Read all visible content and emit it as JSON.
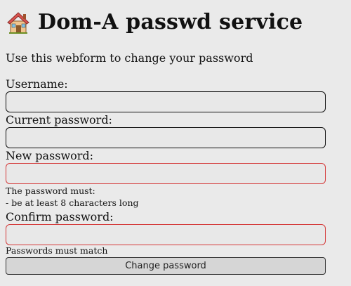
{
  "header": {
    "title": "Dom-A passwd service",
    "icon": "house-icon"
  },
  "intro": "Use this webform to change your password",
  "form": {
    "username": {
      "label": "Username:",
      "value": ""
    },
    "current_password": {
      "label": "Current password:",
      "value": ""
    },
    "new_password": {
      "label": "New password:",
      "value": "",
      "hint_lines": [
        "The password must:",
        "- be at least 8 characters long"
      ]
    },
    "confirm_password": {
      "label": "Confirm password:",
      "value": "",
      "hint": "Passwords must match"
    },
    "submit_label": "Change password"
  },
  "colors": {
    "background": "#eaeaea",
    "invalid_border": "#d53b3b",
    "roof": "#d9534f",
    "wall": "#e8b77a"
  }
}
